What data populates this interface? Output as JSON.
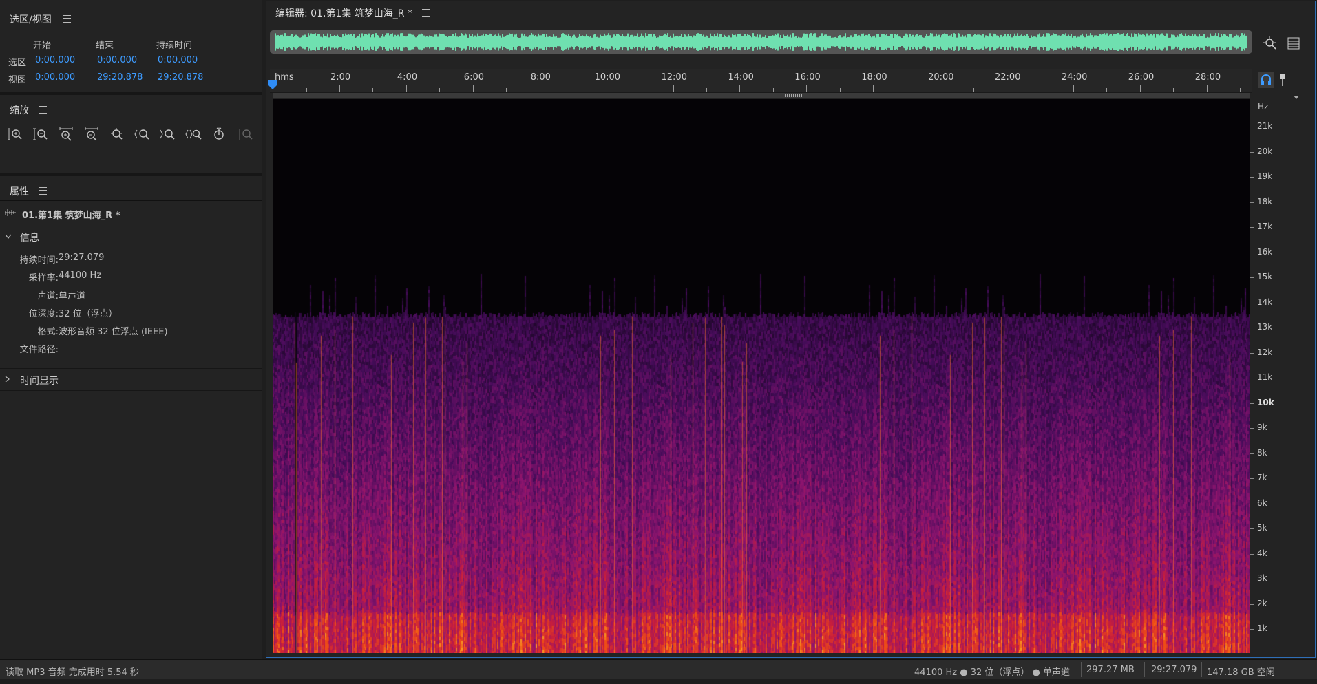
{
  "left": {
    "selection_view": {
      "title": "选区/视图",
      "col_start": "开始",
      "col_end": "结束",
      "col_duration": "持续时间",
      "row_selection": {
        "label": "选区",
        "start": "0:00.000",
        "end": "0:00.000",
        "duration": "0:00.000"
      },
      "row_view": {
        "label": "视图",
        "start": "0:00.000",
        "end": "29:20.878",
        "duration": "29:20.878"
      }
    },
    "zoom": {
      "title": "缩放",
      "buttons": [
        "zoom-in-amplitude",
        "zoom-out-amplitude",
        "zoom-in-time",
        "zoom-out-time",
        "zoom-full",
        "zoom-in-left",
        "zoom-in-right",
        "zoom-out-full",
        "zoom-to-selection",
        "zoom-tool-disabled"
      ]
    },
    "properties": {
      "title": "属性",
      "file_name": "01.第1集 筑梦山海_R *",
      "info_section": "信息",
      "duration_label": "持续时间:",
      "duration": "29:27.079",
      "sample_rate_label": "采样率:",
      "sample_rate": "44100 Hz",
      "channels_label": "声道:",
      "channels": "单声道",
      "bit_depth_label": "位深度:",
      "bit_depth": "32 位（浮点）",
      "format_label": "格式:",
      "format": "波形音频 32 位浮点 (IEEE)",
      "path_label": "文件路径:",
      "time_display_section": "时间显示"
    }
  },
  "editor": {
    "tab_title": "编辑器: 01.第1集 筑梦山海_R *",
    "ruler_unit": "hms",
    "ruler_labels": [
      "2:00",
      "4:00",
      "6:00",
      "8:00",
      "10:00",
      "12:00",
      "14:00",
      "16:00",
      "18:00",
      "20:00",
      "22:00",
      "24:00",
      "26:00",
      "28:00"
    ],
    "hz_unit": "Hz",
    "hz_labels": [
      "21k",
      "20k",
      "19k",
      "18k",
      "17k",
      "16k",
      "15k",
      "14k",
      "13k",
      "12k",
      "11k",
      "10k",
      "9k",
      "8k",
      "7k",
      "6k",
      "5k",
      "4k",
      "3k",
      "2k",
      "1k"
    ]
  },
  "status_bar": {
    "message": "读取 MP3 音频 完成用时 5.54 秒",
    "format_info": "44100 Hz ● 32 位（浮点） ● 单声道",
    "file_size": "297.27 MB",
    "duration": "29:27.079",
    "free_space": "147.18 GB 空闲"
  },
  "colors": {
    "accent": "#3d9bff",
    "waveform": "#6fe0b0",
    "background": "#1e1e1e"
  }
}
